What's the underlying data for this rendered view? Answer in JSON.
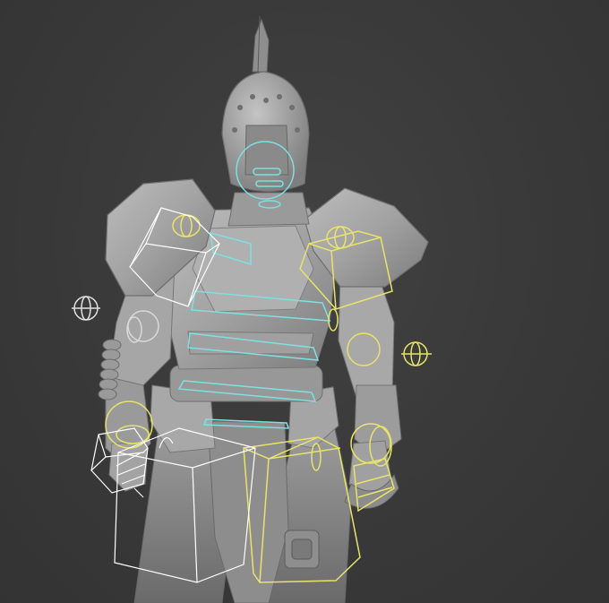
{
  "scene": {
    "background": "#3b3b3b",
    "model_color": "#9c9c9c",
    "model_highlight": "#b5b5b5",
    "model_shadow": "#6e6e6e"
  },
  "rig_colors": {
    "fk_controls": "#e8e36a",
    "ik_boxes": "#ffffff",
    "spine_controls": "#7ee0e0"
  },
  "icons": {
    "pole_target_left": "circle-crosshair-icon",
    "pole_target_right": "circle-crosshair-icon"
  }
}
